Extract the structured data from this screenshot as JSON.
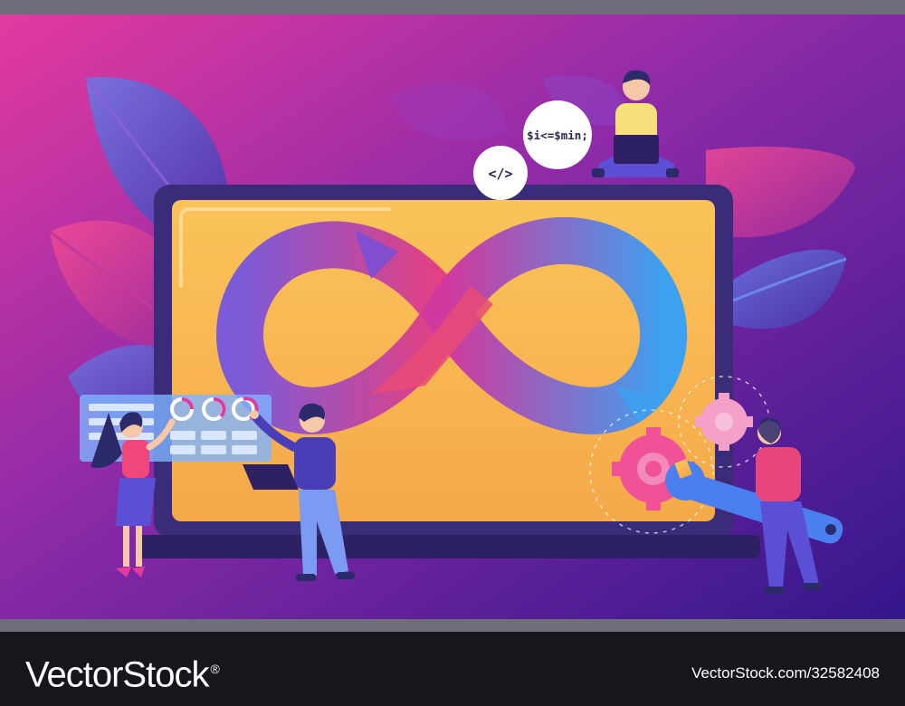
{
  "code_bubbles": {
    "tag": "</>",
    "snippet": "$i<=$min;"
  },
  "watermark": {
    "brand": "VectorStock",
    "registered_mark": "®",
    "image_id": "VectorStock.com/32582408"
  },
  "colors": {
    "background_start": "#d9389c",
    "background_end": "#3d1a8f",
    "screen": "#f7b84f",
    "laptop_frame": "#3a2c78",
    "footer": "#16161c",
    "strip": "#6f6f7c"
  },
  "icons": [
    "infinity-loop-icon",
    "code-tag-icon",
    "gear-icon",
    "wrench-icon",
    "progress-ring-icon",
    "laptop-icon"
  ]
}
